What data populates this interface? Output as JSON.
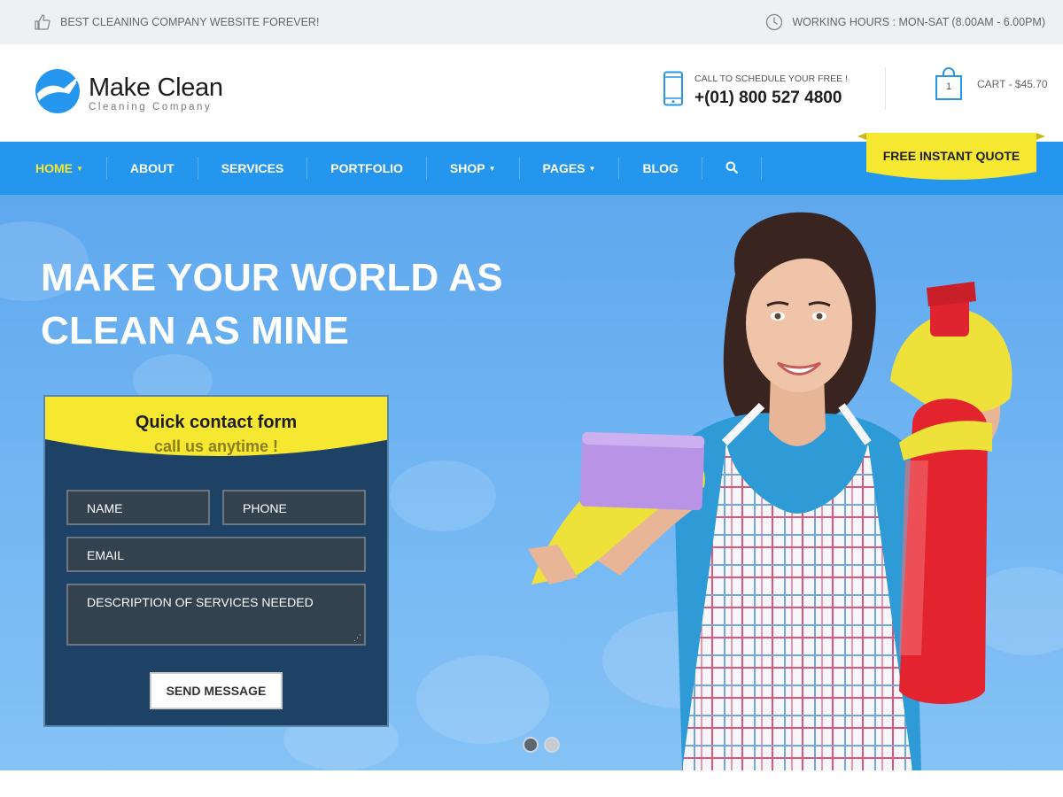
{
  "topbar": {
    "tagline": "BEST CLEANING COMPANY WEBSITE FOREVER!",
    "tagline_icon": "thumbs-up-icon",
    "hours": "WORKING HOURS : MON-SAT (8.00AM - 6.00PM)",
    "hours_icon": "clock-icon"
  },
  "header": {
    "logo_name": "Make Clean",
    "logo_tagline": "Cleaning Company",
    "call_label": "CALL TO SCHEDULE YOUR FREE !",
    "phone": "+(01) 800 527 4800",
    "phone_icon": "phone-icon",
    "cart_count": "1",
    "cart_text": "CART - $45.70",
    "cart_icon": "shopping-bag-icon"
  },
  "nav": {
    "items": [
      {
        "label": "HOME",
        "has_caret": true,
        "active": true
      },
      {
        "label": "ABOUT"
      },
      {
        "label": "SERVICES"
      },
      {
        "label": "PORTFOLIO"
      },
      {
        "label": "SHOP",
        "has_caret": true
      },
      {
        "label": "PAGES",
        "has_caret": true
      },
      {
        "label": "BLOG"
      }
    ],
    "search_icon": "search-icon",
    "quote_label": "FREE INSTANT QUOTE"
  },
  "hero": {
    "title_line1": "MAKE YOUR WORLD AS",
    "title_line2": "CLEAN AS MINE",
    "slides_total": 2,
    "active_slide": 1
  },
  "form": {
    "title": "Quick contact form",
    "subtitle": "call us anytime !",
    "name_placeholder": "NAME",
    "phone_placeholder": "PHONE",
    "email_placeholder": "EMAIL",
    "description_placeholder": "DESCRIPTION OF SERVICES NEEDED",
    "submit_label": "SEND MESSAGE"
  },
  "colors": {
    "nav_blue": "#2496ee",
    "accent_yellow": "#f6e731",
    "form_navy": "#1e4266",
    "topbar_gray": "#eef0f2"
  }
}
